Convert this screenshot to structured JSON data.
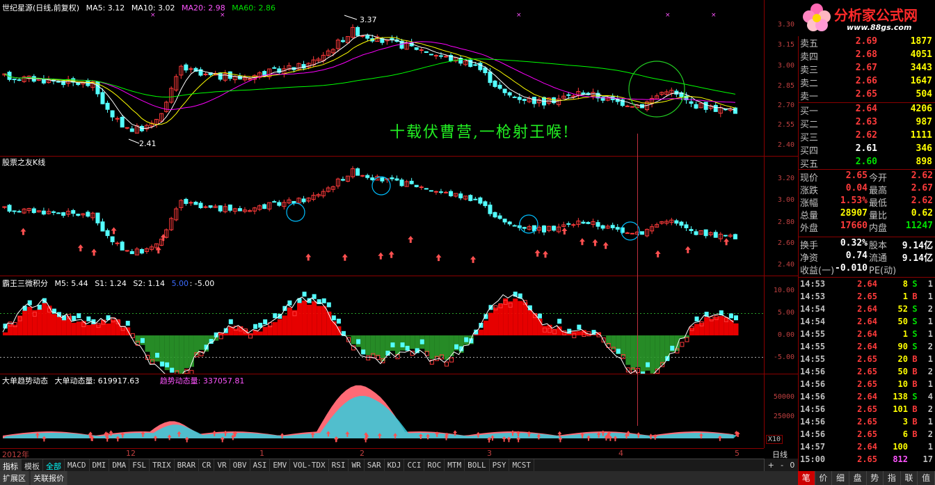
{
  "main_panel": {
    "title": "世纪星源(日线,前复权)",
    "ma5": "MA5: 3.12",
    "ma10": "MA10: 3.02",
    "ma20": "MA20: 2.98",
    "ma60": "MA60: 2.86",
    "high_label": "3.37",
    "low_label": "2.41",
    "poem": "十载伏曹营,一枪射王喉!",
    "ticks": [
      "3.30",
      "3.15",
      "3.00",
      "2.85",
      "2.70",
      "2.55",
      "2.40"
    ]
  },
  "panel2": {
    "title": "股票之友K线",
    "ticks": [
      "3.20",
      "3.00",
      "2.80",
      "2.60",
      "2.40"
    ]
  },
  "panel3": {
    "title": "霸王三微积分",
    "m5": "M5: 5.44",
    "s1": "S1: 1.24",
    "s2": "S2: 1.14",
    "a": "5.00",
    "b": ": -5.00",
    "ticks": [
      "10.00",
      "5.00",
      "0.00",
      "-5.00"
    ]
  },
  "panel4": {
    "title": "大单趋势动态",
    "big": "大单动态量: 619917.63",
    "trend": "趋势动态量: 337057.81",
    "ticks": [
      "50000",
      "25000"
    ],
    "unit": "X10"
  },
  "dates": {
    "year": "2012年",
    "labels": [
      "12",
      "1",
      "2",
      "3",
      "4",
      "5"
    ],
    "period": "日线"
  },
  "tabs": [
    "指标",
    "模板",
    "全部",
    "MACD",
    "DMI",
    "DMA",
    "FSL",
    "TRIX",
    "BRAR",
    "CR",
    "VR",
    "OBV",
    "ASI",
    "EMV",
    "VOL-TDX",
    "RSI",
    "WR",
    "SAR",
    "KDJ",
    "CCI",
    "ROC",
    "MTM",
    "BOLL",
    "PSY",
    "MCST"
  ],
  "bottom_tabs": [
    "扩展区",
    "关联报价"
  ],
  "controls": [
    "+",
    "-",
    "0"
  ],
  "logo": {
    "brand": "分析家公式网",
    "url": "www.88gs.com"
  },
  "sell_orders": [
    {
      "label": "卖五",
      "price": "2.69",
      "vol": "1877"
    },
    {
      "label": "卖四",
      "price": "2.68",
      "vol": "4051"
    },
    {
      "label": "卖三",
      "price": "2.67",
      "vol": "3443"
    },
    {
      "label": "卖二",
      "price": "2.66",
      "vol": "1647"
    },
    {
      "label": "卖一",
      "price": "2.65",
      "vol": "504"
    }
  ],
  "buy_orders": [
    {
      "label": "买一",
      "price": "2.64",
      "vol": "4206"
    },
    {
      "label": "买二",
      "price": "2.63",
      "vol": "987"
    },
    {
      "label": "买三",
      "price": "2.62",
      "vol": "1111"
    },
    {
      "label": "买四",
      "price": "2.61",
      "vol": "346"
    },
    {
      "label": "买五",
      "price": "2.60",
      "vol": "898"
    }
  ],
  "stats": [
    {
      "l1": "现价",
      "v1": "2.65",
      "c1": "red",
      "l2": "今开",
      "v2": "2.62",
      "c2": "red"
    },
    {
      "l1": "涨跌",
      "v1": "0.04",
      "c1": "red",
      "l2": "最高",
      "v2": "2.67",
      "c2": "red"
    },
    {
      "l1": "涨幅",
      "v1": "1.53%",
      "c1": "red",
      "l2": "最低",
      "v2": "2.62",
      "c2": "red"
    },
    {
      "l1": "总量",
      "v1": "28907",
      "c1": "yel",
      "l2": "量比",
      "v2": "0.62",
      "c2": "yel"
    },
    {
      "l1": "外盘",
      "v1": "17660",
      "c1": "red",
      "l2": "内盘",
      "v2": "11247",
      "c2": "green"
    },
    {
      "l1": "换手",
      "v1": "0.32%",
      "c1": "white",
      "l2": "股本",
      "v2": "9.14亿",
      "c2": "white"
    },
    {
      "l1": "净资",
      "v1": "0.74",
      "c1": "white",
      "l2": "流通",
      "v2": "9.14亿",
      "c2": "white"
    },
    {
      "l1": "收益(一)",
      "v1": "-0.010",
      "c1": "white",
      "l2": "PE(动)",
      "v2": "",
      "c2": "white"
    }
  ],
  "ticks_trades": [
    {
      "t": "14:53",
      "p": "2.64",
      "v": "8",
      "d": "S",
      "n": "1"
    },
    {
      "t": "14:53",
      "p": "2.65",
      "v": "1",
      "d": "B",
      "n": "1"
    },
    {
      "t": "14:54",
      "p": "2.64",
      "v": "52",
      "d": "S",
      "n": "2"
    },
    {
      "t": "14:54",
      "p": "2.64",
      "v": "50",
      "d": "S",
      "n": "1"
    },
    {
      "t": "14:55",
      "p": "2.64",
      "v": "1",
      "d": "S",
      "n": "1"
    },
    {
      "t": "14:55",
      "p": "2.64",
      "v": "90",
      "d": "S",
      "n": "2"
    },
    {
      "t": "14:55",
      "p": "2.65",
      "v": "20",
      "d": "B",
      "n": "1"
    },
    {
      "t": "14:56",
      "p": "2.65",
      "v": "50",
      "d": "B",
      "n": "2"
    },
    {
      "t": "14:56",
      "p": "2.65",
      "v": "10",
      "d": "B",
      "n": "1"
    },
    {
      "t": "14:56",
      "p": "2.64",
      "v": "138",
      "d": "S",
      "n": "4"
    },
    {
      "t": "14:56",
      "p": "2.65",
      "v": "101",
      "d": "B",
      "n": "2"
    },
    {
      "t": "14:56",
      "p": "2.65",
      "v": "3",
      "d": "B",
      "n": "1"
    },
    {
      "t": "14:56",
      "p": "2.65",
      "v": "6",
      "d": "B",
      "n": "2"
    },
    {
      "t": "14:57",
      "p": "2.64",
      "v": "100",
      "d": "",
      "n": "1"
    },
    {
      "t": "15:00",
      "p": "2.65",
      "v": "812",
      "d": "",
      "n": "17"
    }
  ],
  "side_tabs": [
    "笔",
    "价",
    "细",
    "盘",
    "势",
    "指",
    "联",
    "值"
  ],
  "colors": {
    "up": "#ff3b3b",
    "down": "#54ffff",
    "border": "#8b0000",
    "ma5": "#ffffff",
    "ma10": "#ffff00",
    "ma20": "#ff00ff",
    "ma60": "#00ff00"
  }
}
